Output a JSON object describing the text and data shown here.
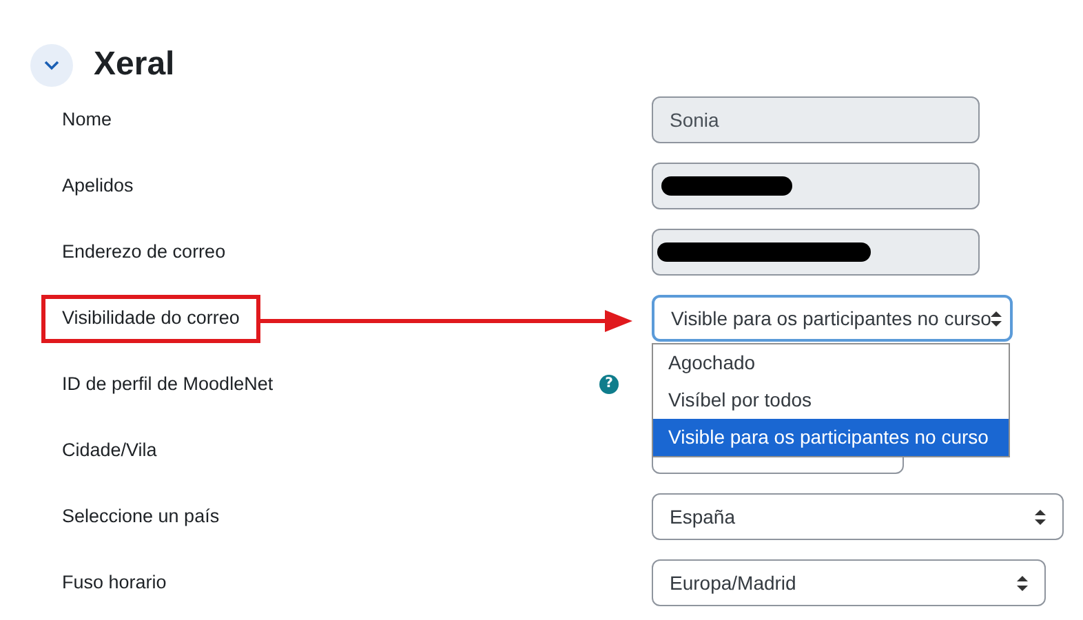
{
  "section": {
    "title": "Xeral",
    "expanded": true
  },
  "fields": [
    {
      "label": "Nome",
      "kind": "readonly",
      "value": "Sonia"
    },
    {
      "label": "Apelidos",
      "kind": "redacted"
    },
    {
      "label": "Enderezo de correo",
      "kind": "redacted"
    },
    {
      "label": "Visibilidade do correo",
      "kind": "select",
      "value": "Visible para os participantes no curso",
      "annotated": true,
      "open": true,
      "options": [
        {
          "label": "Agochado",
          "selected": false
        },
        {
          "label": "Visíbel por todos",
          "selected": false
        },
        {
          "label": "Visible para os participantes no curso",
          "selected": true
        }
      ]
    },
    {
      "label": "ID de perfil de MoodleNet",
      "kind": "hidden",
      "help": "?"
    },
    {
      "label": "Cidade/Vila",
      "kind": "text"
    },
    {
      "label": "Seleccione un país",
      "kind": "select",
      "value": "España",
      "open": false
    },
    {
      "label": "Fuso horario",
      "kind": "select",
      "value": "Europa/Madrid",
      "open": false
    }
  ]
}
